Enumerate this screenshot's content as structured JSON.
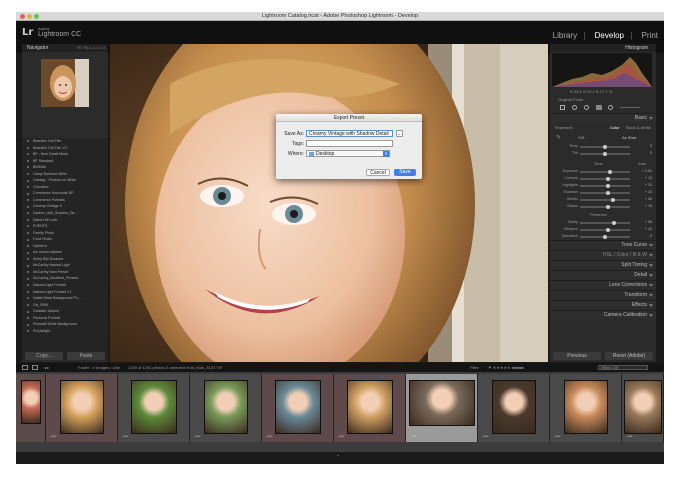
{
  "window": {
    "title": "Lightroom Catalog.lrcat - Adobe Photoshop Lightroom - Develop"
  },
  "identity": {
    "logo": "Lr",
    "adobe": "Adobe",
    "product": "Lightroom CC"
  },
  "modules": [
    "Library",
    "Develop",
    "Print"
  ],
  "navigator": {
    "title": "Navigator",
    "zoom": "FIT  FILL  1:1  1:4"
  },
  "presets": [
    "Beautiful Old Film",
    "Beautiful Old Film V.2",
    "BF - New Detail Mods",
    "BF Standard",
    "BWKids",
    "Camp Rainbow B&W",
    "Catalog - Product on White",
    "Cherokee",
    "Commerce Horizontal BP",
    "Commerce Portraits",
    "Creamy Vintage II",
    "Darken_with_Shadow_De...",
    "Diane Hill Look",
    "EVENTS",
    "Family Photo",
    "Food Finals",
    "Hydefmx",
    "Ice cream capture",
    "Kelby BW Duotone",
    "McCarthy Natural Light",
    "McCarthy New Preset",
    "McCarthy_Modified_Presets",
    "Natural Light Portrait",
    "Natural Light Portrait v.2",
    "Nulda Black Background Po...",
    "Ort_SNM",
    "Outsider Darken",
    "Personal Portrait",
    "Pinkwelt White Background",
    "Purplelight"
  ],
  "left_buttons": {
    "copy": "Copy...",
    "paste": "Paste"
  },
  "dialog": {
    "title": "Export Preset",
    "save_as_label": "Save As:",
    "save_as_value": "Creamy Vintage with Shadow Detail",
    "tags_label": "Tags:",
    "tags_value": "",
    "where_label": "Where:",
    "where_value": "Desktop",
    "cancel": "Cancel",
    "save": "Save"
  },
  "right_panel": {
    "histogram": "Histogram",
    "readout": "R 29.1   G 22.7   B 17.7 %",
    "original_photo": "Original Photo",
    "basic": "Basic",
    "treatment": "Treatment :",
    "color": "Color",
    "bw": "Black & White",
    "wb": "WB :",
    "as_shot": "As Shot",
    "tone": "Tone",
    "auto": "Auto",
    "presence": "Presence",
    "sliders_wb": [
      {
        "label": "Temp",
        "value": "0"
      },
      {
        "label": "Tint",
        "value": "0"
      }
    ],
    "sliders_tone": [
      {
        "label": "Exposure",
        "value": "+ 1.01",
        "pos": 0.6
      },
      {
        "label": "Contrast",
        "value": "+ 13",
        "pos": 0.56
      },
      {
        "label": "Highlights",
        "value": "+ 12",
        "pos": 0.56
      },
      {
        "label": "Shadows",
        "value": "+ 12",
        "pos": 0.56
      },
      {
        "label": "Whites",
        "value": "+ 30",
        "pos": 0.65
      },
      {
        "label": "Blacks",
        "value": "+ 10",
        "pos": 0.55
      }
    ],
    "sliders_presence": [
      {
        "label": "Clarity",
        "value": "+ 34",
        "pos": 0.67
      },
      {
        "label": "Vibrance",
        "value": "+ 12",
        "pos": 0.56
      },
      {
        "label": "Saturation",
        "value": "- 2",
        "pos": 0.49
      }
    ],
    "hsl": "HSL  /  Color  /  B & W",
    "sections": [
      "Tone Curve",
      "Split Toning",
      "Detail",
      "Lens Corrections",
      "Transform",
      "Effects",
      "Camera Calibration"
    ],
    "previous": "Previous",
    "reset": "Reset (Adobe)"
  },
  "filmstrip": {
    "source": "Folder : 4 Images I Like",
    "info": "1249 of 1251 photos /1 selected /Kim_Kids_3147.TIF",
    "filter_label": "Filter :",
    "filter_value": "Filters Off",
    "ratings": [
      "****",
      "****",
      "****",
      "****",
      "****",
      "****",
      "****",
      "****",
      "****"
    ]
  }
}
